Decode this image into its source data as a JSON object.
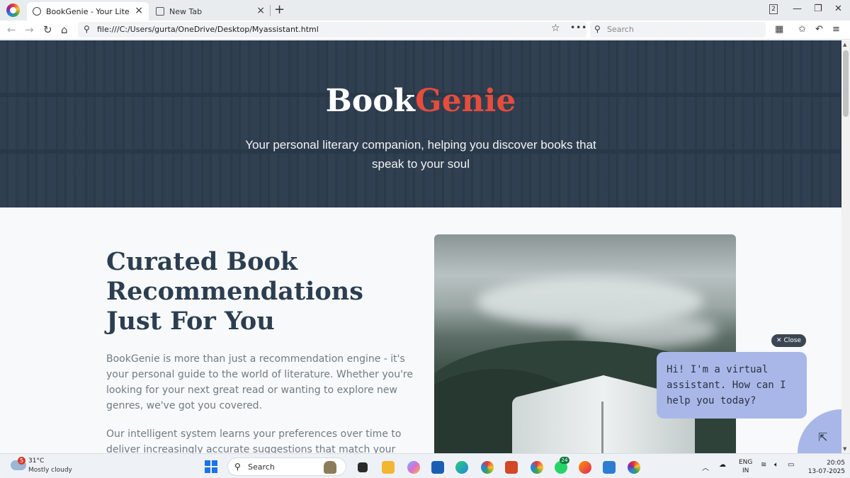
{
  "browser": {
    "active_tab_title": "BookGenie - Your Literary Co",
    "inactive_tab_title": "New Tab",
    "tab_count": "2",
    "url": "file:///C:/Users/gurta/OneDrive/Desktop/Myassistant.html",
    "search_placeholder": "Search"
  },
  "hero": {
    "brand_main": "Book",
    "brand_accent": "Genie",
    "tagline": "Your personal literary companion, helping you discover books that speak to your soul"
  },
  "main": {
    "headline": "Curated Book Recommendations Just For You",
    "paragraph1": "BookGenie is more than just a recommendation engine - it's your personal guide to the world of literature. Whether you're looking for your next great read or wanting to explore new genres, we've got you covered.",
    "paragraph2": "Our intelligent system learns your preferences over time to deliver increasingly accurate suggestions that match your unique taste."
  },
  "chat": {
    "close_label": "Close",
    "greeting": "Hi! I'm a virtual assistant. How can I help you today?"
  },
  "taskbar": {
    "weather_badge": "5",
    "temperature": "31°C",
    "weather_desc": "Mostly cloudy",
    "search_label": "Search",
    "whatsapp_badge": "24",
    "language": "ENG",
    "region": "IN",
    "time": "20:05",
    "date": "13-07-2025"
  },
  "colors": {
    "brand_accent": "#e74c3c",
    "heading": "#2c3e50",
    "chat_bubble": "#a9b7e8"
  }
}
